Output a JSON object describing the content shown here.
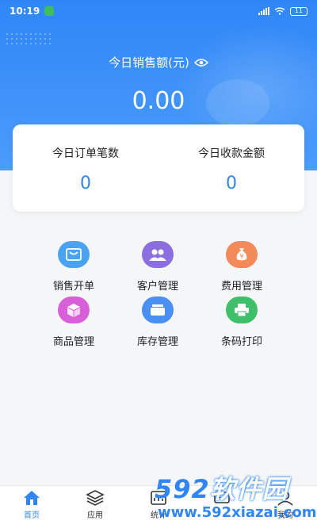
{
  "status": {
    "time": "10:19",
    "battery": "11"
  },
  "summary": {
    "sales_label": "今日销售额(元)",
    "sales_value": "0.00",
    "orders_label": "今日订单笔数",
    "orders_value": "0",
    "receipts_label": "今日收款金额",
    "receipts_value": "0"
  },
  "menu": [
    {
      "label": "销售开单",
      "icon": "cart-icon",
      "color": "#4aa3f2"
    },
    {
      "label": "客户管理",
      "icon": "users-icon",
      "color": "#8b6fe0"
    },
    {
      "label": "费用管理",
      "icon": "money-bag-icon",
      "color": "#f28a5a"
    },
    {
      "label": "商品管理",
      "icon": "box-icon",
      "color": "#d85fd8"
    },
    {
      "label": "库存管理",
      "icon": "inventory-icon",
      "color": "#4a8ff2"
    },
    {
      "label": "条码打印",
      "icon": "printer-icon",
      "color": "#3fbf6a"
    }
  ],
  "tabs": [
    {
      "label": "首页",
      "icon": "home-icon"
    },
    {
      "label": "应用",
      "icon": "layers-icon"
    },
    {
      "label": "统计",
      "icon": "chart-icon"
    },
    {
      "label": "",
      "icon": "message-icon"
    },
    {
      "label": "我的",
      "icon": "user-icon"
    }
  ],
  "watermark": {
    "brand": "592",
    "brand_cn": "软件园",
    "url": "www.592xiazai.com"
  },
  "colors": {
    "primary": "#2f86f6",
    "background": "#f5f6f8"
  }
}
